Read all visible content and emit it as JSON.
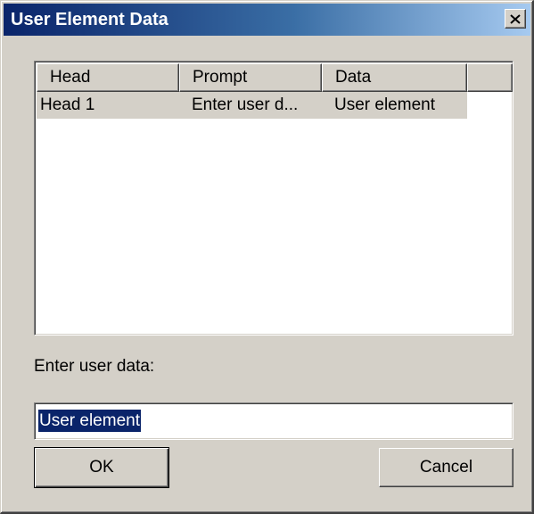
{
  "window": {
    "title": "User Element Data",
    "close_icon": "close-icon"
  },
  "listview": {
    "columns": [
      "Head",
      "Prompt",
      "Data"
    ],
    "rows": [
      {
        "head": "Head 1",
        "prompt": "Enter user d...",
        "data": "User element"
      }
    ]
  },
  "form": {
    "label": "Enter user data:",
    "input_value": "User element"
  },
  "buttons": {
    "ok_label": "OK",
    "cancel_label": "Cancel"
  },
  "colors": {
    "title_gradient_start": "#0a246a",
    "title_gradient_end": "#a6caf0",
    "face": "#d4d0c8",
    "selection": "#0a246a"
  }
}
